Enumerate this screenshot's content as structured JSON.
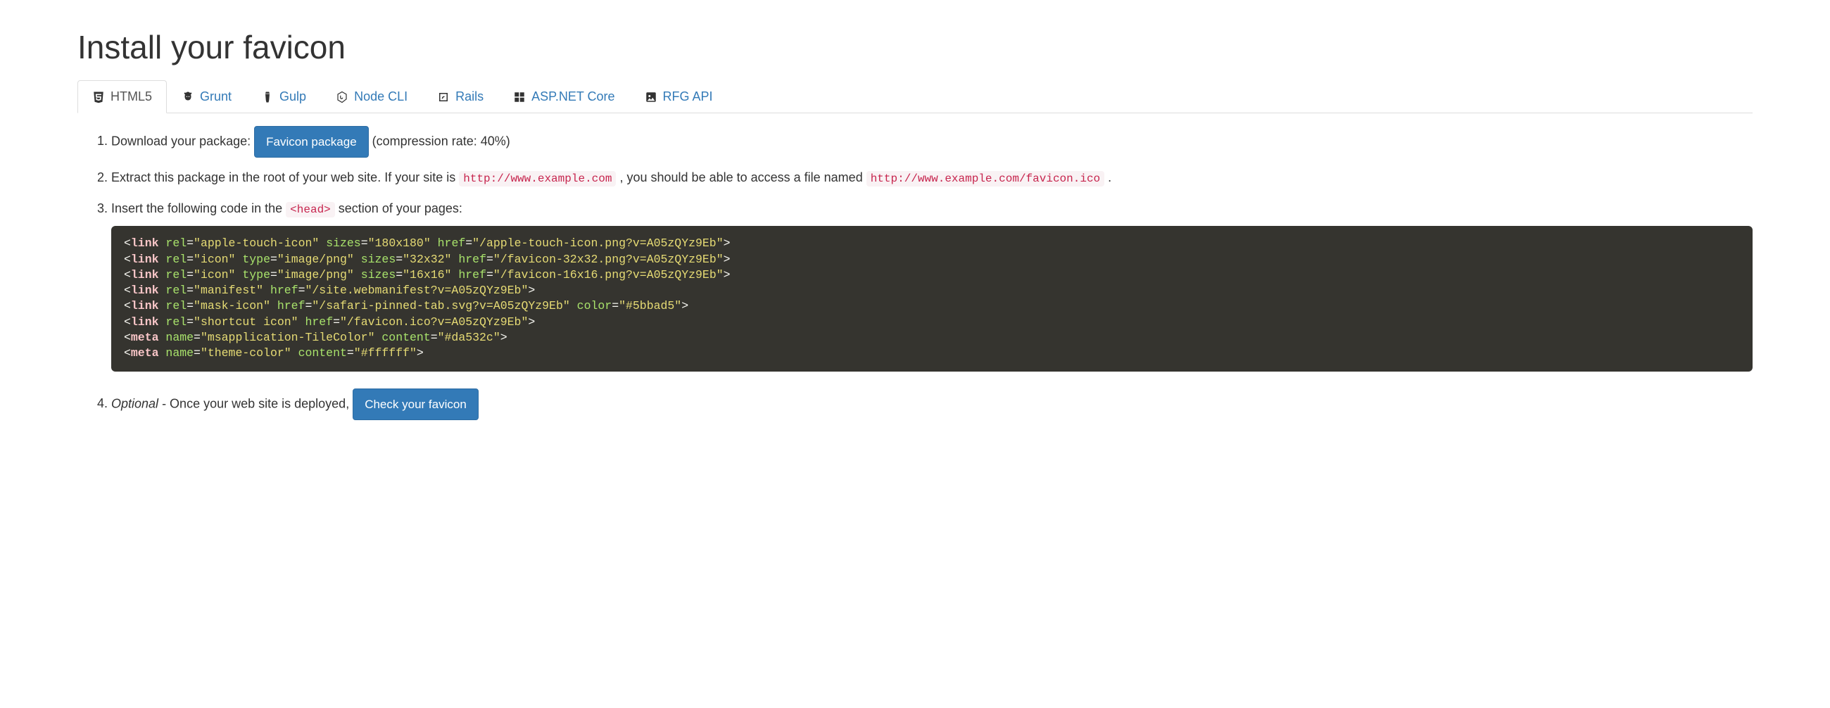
{
  "title": "Install your favicon",
  "tabs": [
    {
      "label": "HTML5",
      "icon": "html5-icon"
    },
    {
      "label": "Grunt",
      "icon": "grunt-icon"
    },
    {
      "label": "Gulp",
      "icon": "gulp-icon"
    },
    {
      "label": "Node CLI",
      "icon": "nodejs-icon"
    },
    {
      "label": "Rails",
      "icon": "rails-icon"
    },
    {
      "label": "ASP.NET Core",
      "icon": "aspnet-icon"
    },
    {
      "label": "RFG API",
      "icon": "rfg-icon"
    }
  ],
  "steps": {
    "s1_pre": "Download your package: ",
    "s1_button": "Favicon package",
    "s1_post": " (compression rate: 40%)",
    "s2_pre": "Extract this package in the root of your web site. If your site is ",
    "s2_code1": "http://www.example.com",
    "s2_mid": ", you should be able to access a file named ",
    "s2_code2": "http://www.example.com/favicon.ico",
    "s2_post": ".",
    "s3_pre": "Insert the following code in the ",
    "s3_code": "<head>",
    "s3_post": " section of your pages:",
    "s4_optional": "Optional",
    "s4_mid": " - Once your web site is deployed, ",
    "s4_button": "Check your favicon"
  },
  "code_lines": [
    {
      "tag": "link",
      "attrs": [
        {
          "name": "rel",
          "value": "apple-touch-icon"
        },
        {
          "name": "sizes",
          "value": "180x180"
        },
        {
          "name": "href",
          "value": "/apple-touch-icon.png?v=A05zQYz9Eb"
        }
      ]
    },
    {
      "tag": "link",
      "attrs": [
        {
          "name": "rel",
          "value": "icon"
        },
        {
          "name": "type",
          "value": "image/png"
        },
        {
          "name": "sizes",
          "value": "32x32"
        },
        {
          "name": "href",
          "value": "/favicon-32x32.png?v=A05zQYz9Eb"
        }
      ]
    },
    {
      "tag": "link",
      "attrs": [
        {
          "name": "rel",
          "value": "icon"
        },
        {
          "name": "type",
          "value": "image/png"
        },
        {
          "name": "sizes",
          "value": "16x16"
        },
        {
          "name": "href",
          "value": "/favicon-16x16.png?v=A05zQYz9Eb"
        }
      ]
    },
    {
      "tag": "link",
      "attrs": [
        {
          "name": "rel",
          "value": "manifest"
        },
        {
          "name": "href",
          "value": "/site.webmanifest?v=A05zQYz9Eb"
        }
      ]
    },
    {
      "tag": "link",
      "attrs": [
        {
          "name": "rel",
          "value": "mask-icon"
        },
        {
          "name": "href",
          "value": "/safari-pinned-tab.svg?v=A05zQYz9Eb"
        },
        {
          "name": "color",
          "value": "#5bbad5"
        }
      ]
    },
    {
      "tag": "link",
      "attrs": [
        {
          "name": "rel",
          "value": "shortcut icon"
        },
        {
          "name": "href",
          "value": "/favicon.ico?v=A05zQYz9Eb"
        }
      ]
    },
    {
      "tag": "meta",
      "attrs": [
        {
          "name": "name",
          "value": "msapplication-TileColor"
        },
        {
          "name": "content",
          "value": "#da532c"
        }
      ]
    },
    {
      "tag": "meta",
      "attrs": [
        {
          "name": "name",
          "value": "theme-color"
        },
        {
          "name": "content",
          "value": "#ffffff"
        }
      ]
    }
  ]
}
